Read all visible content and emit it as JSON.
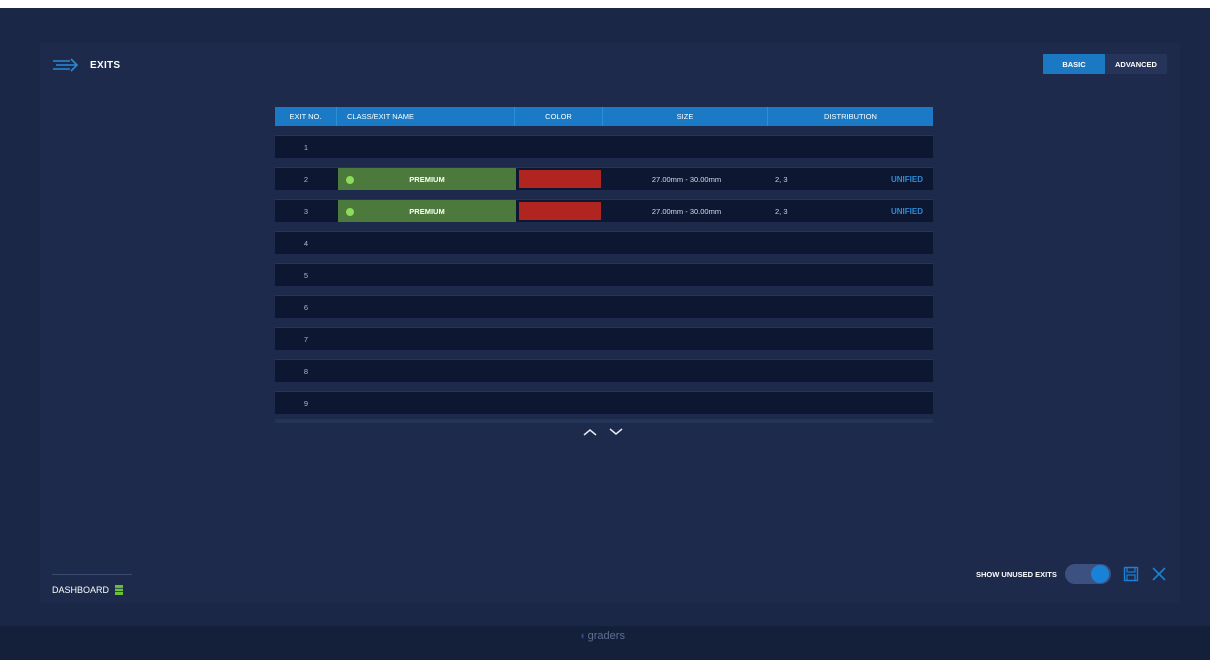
{
  "header": {
    "title": "EXITS"
  },
  "mode": {
    "basic_label": "BASIC",
    "advanced_label": "ADVANCED"
  },
  "table": {
    "columns": [
      "EXIT NO.",
      "CLASS/EXIT NAME",
      "COLOR",
      "SIZE",
      "DISTRIBUTION"
    ],
    "rows": [
      {
        "no": "1"
      },
      {
        "no": "2",
        "name": "PREMIUM",
        "color": "#b0251f",
        "size": "27.00mm - 30.00mm",
        "dist": "2, 3",
        "dist_mode": "UNIFIED"
      },
      {
        "no": "3",
        "name": "PREMIUM",
        "color": "#b0251f",
        "size": "27.00mm - 30.00mm",
        "dist": "2, 3",
        "dist_mode": "UNIFIED"
      },
      {
        "no": "4"
      },
      {
        "no": "5"
      },
      {
        "no": "6"
      },
      {
        "no": "7"
      },
      {
        "no": "8"
      },
      {
        "no": "9"
      }
    ]
  },
  "footer": {
    "dashboard_label": "DASHBOARD",
    "show_unused_label": "SHOW UNUSED EXITS",
    "show_unused_on": true,
    "brand": "graders"
  },
  "icons": {
    "exits": "arrows-right-icon",
    "dashboard": "bar-icon",
    "save": "floppy-disk-icon",
    "close": "close-icon",
    "up": "chevron-up-icon",
    "down": "chevron-down-icon"
  },
  "colors": {
    "accent": "#1a7ac6",
    "premium_class": "#4c7a3c",
    "premium_dot": "#8cdc5a",
    "unified": "#2c8bd8"
  }
}
